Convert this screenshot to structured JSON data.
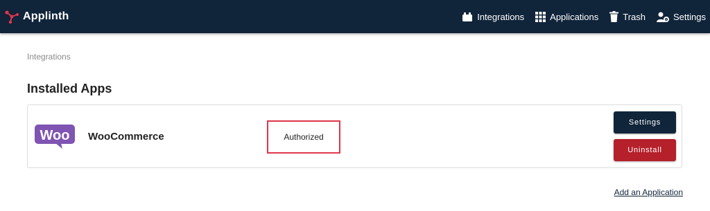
{
  "header": {
    "brand": "Applinth",
    "nav": [
      {
        "label": "Integrations",
        "icon": "integrations-icon"
      },
      {
        "label": "Applications",
        "icon": "grid-icon"
      },
      {
        "label": "Trash",
        "icon": "trash-icon"
      },
      {
        "label": "Settings",
        "icon": "user-settings-icon"
      }
    ]
  },
  "breadcrumb": "Integrations",
  "page_title": "Installed Apps",
  "app": {
    "logo_text": "Woo",
    "name": "WooCommerce",
    "status": "Authorized",
    "settings_label": "Settings",
    "uninstall_label": "Uninstall"
  },
  "add_application_link": "Add an Application",
  "colors": {
    "header_bg": "#10243a",
    "uninstall_red": "#b5202a",
    "woo_purple": "#7f54b3",
    "highlight_red": "#e0354a"
  }
}
